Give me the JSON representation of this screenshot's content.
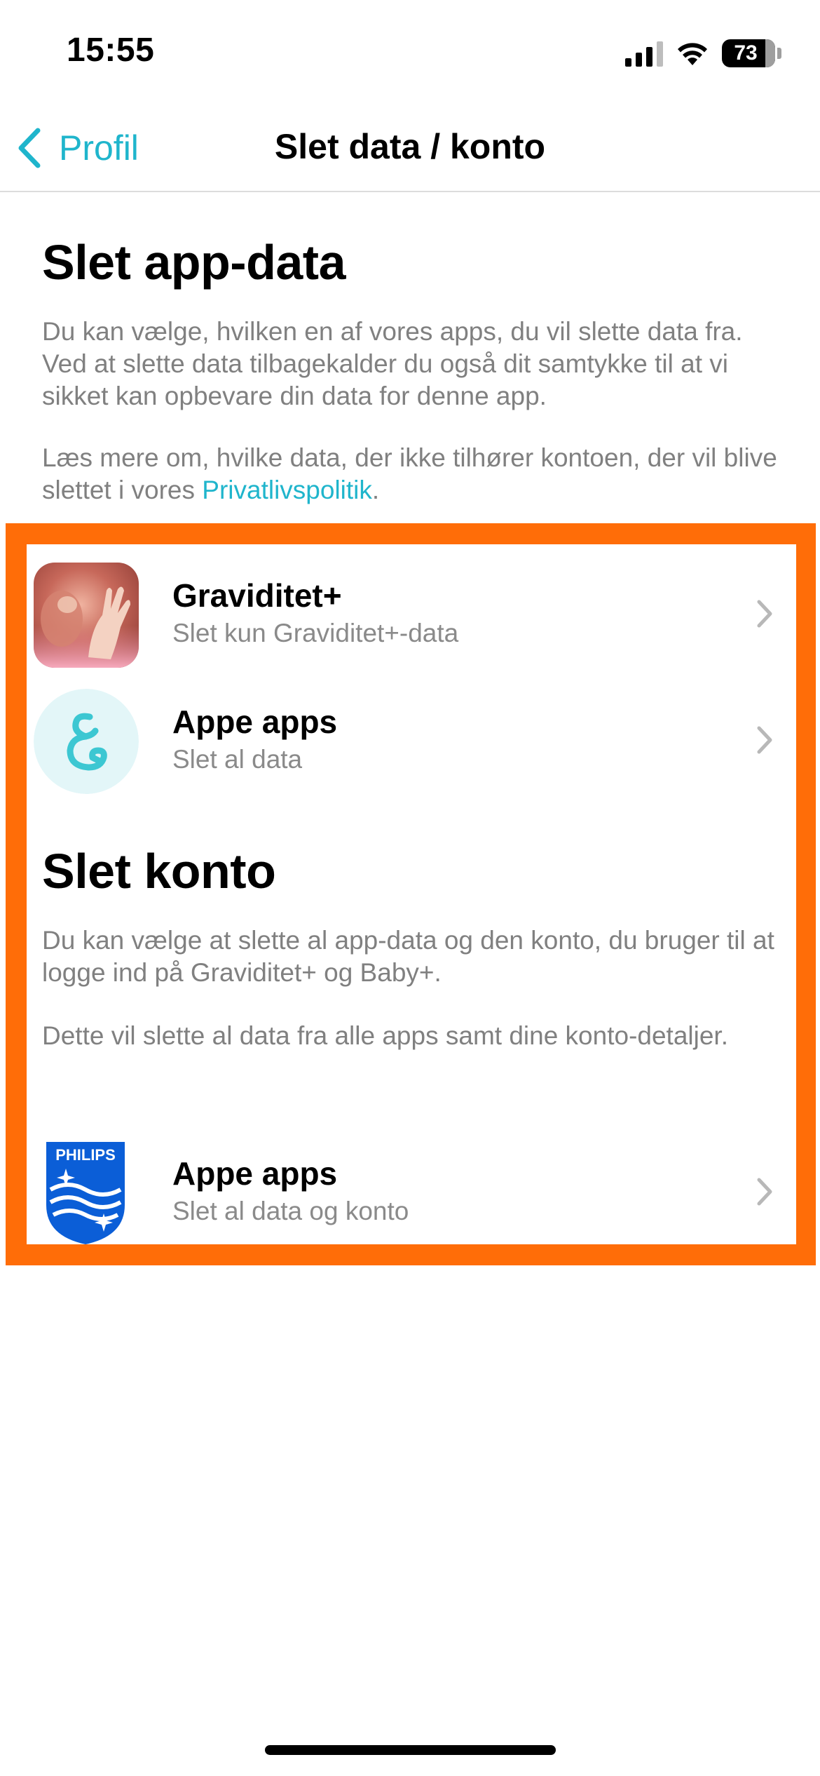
{
  "status_bar": {
    "time": "15:55",
    "battery": "73",
    "icons": [
      "cellular-signal-icon",
      "wifi-icon",
      "battery-icon"
    ]
  },
  "nav": {
    "back_label": "Profil",
    "title": "Slet data / konto"
  },
  "delete_app_data": {
    "title": "Slet app-data",
    "paragraph1": "Du kan vælge, hvilken en af vores apps, du vil slette data fra. Ved at slette data tilbagekalder du også dit samtykke til at vi sikket kan opbevare din data for denne app.",
    "paragraph2_prefix": "Læs mere om, hvilke data, der ikke tilhører kontoen, der vil blive slettet i vores ",
    "paragraph2_link": "Privatlivspolitik",
    "paragraph2_suffix": ".",
    "items": [
      {
        "title": "Graviditet+",
        "subtitle": "Slet kun Graviditet+-data",
        "icon": "graviditet-app-icon"
      },
      {
        "title": "Appe apps",
        "subtitle": "Slet al data",
        "icon": "appe-apps-logo-icon"
      }
    ]
  },
  "delete_account": {
    "title": "Slet konto",
    "paragraph1": "Du kan vælge at slette al app-data og den konto, du bruger til at logge ind på Graviditet+ og Baby+.",
    "paragraph2": "Dette vil slette al data fra alle apps samt dine konto-detaljer.",
    "item": {
      "title": "Appe apps",
      "subtitle": "Slet al data og konto",
      "icon": "philips-shield-icon",
      "logo_text": "PHILIPS"
    }
  },
  "colors": {
    "accent": "#1fb5cc",
    "highlight": "#ff6d08",
    "secondary_text": "#808080"
  }
}
